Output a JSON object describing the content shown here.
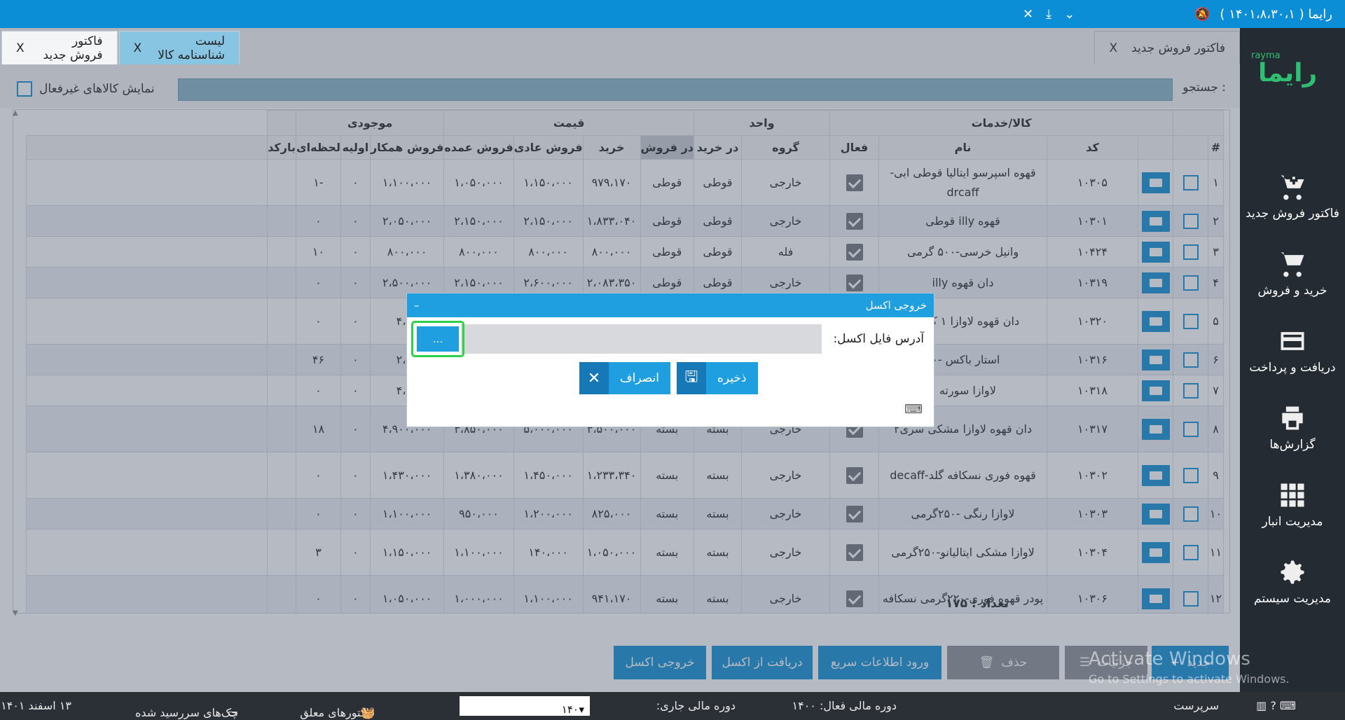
{
  "titlebar": {
    "title": "رایما ( ۱۴۰۱،۸،۳۰،۱ )",
    "icons": [
      "bell-off-icon",
      "chevron-down-icon",
      "minimize-icon",
      "close-icon"
    ]
  },
  "sidebar": {
    "logo_latin": "rayma",
    "logo_text": "رایما",
    "items": [
      {
        "label": "فاکتور فروش جدید",
        "icon": "cart-plus-icon"
      },
      {
        "label": "خرید و فروش",
        "icon": "cart-icon"
      },
      {
        "label": "دریافت و پرداخت",
        "icon": "credit-card-icon"
      },
      {
        "label": "گزارش‌ها",
        "icon": "printer-icon"
      },
      {
        "label": "مدیریت انبار",
        "icon": "grid-icon"
      },
      {
        "label": "مدیریت سیستم",
        "icon": "gear-icon"
      }
    ]
  },
  "tabs": [
    {
      "label": "لیست شناسنامه کالا",
      "close": "X"
    },
    {
      "label": "فاکتور فروش جدید",
      "close": "X"
    }
  ],
  "search": {
    "label": "جستجو :",
    "value": ""
  },
  "inactive_label": "نمایش کالاهای غیرفعال",
  "table": {
    "group_headers": {
      "goods": "کالا/خدمات",
      "unit": "واحد",
      "price": "قیمت",
      "stock": "موجودی"
    },
    "columns": [
      "#",
      "کد",
      "نام",
      "فعال",
      "گروه",
      "در خرید",
      "در فروش",
      "خرید",
      "فروش عادی",
      "فروش عمده",
      "فروش همکار",
      "اولیه",
      "لحظه‌ای",
      "بارکد"
    ],
    "rows": [
      {
        "n": "۱",
        "code": "۱۰۳۰۵",
        "name": "قهوه اسپرسو ایتالیا قوطی ابی-drcaff",
        "group": "خارجی",
        "ub": "قوطی",
        "us": "قوطی",
        "buy": "۹۷۹،۱۷۰",
        "reg": "۱،۱۵۰،۰۰۰",
        "whole": "۱،۰۵۰،۰۰۰",
        "part": "۱،۱۰۰،۰۰۰",
        "init": "۰",
        "now": "-۱"
      },
      {
        "n": "۲",
        "code": "۱۰۳۰۱",
        "name": "قهوه illy قوطی",
        "group": "خارجی",
        "ub": "قوطی",
        "us": "قوطی",
        "buy": "۱،۸۳۳،۰۴۰",
        "reg": "۲،۱۵۰،۰۰۰",
        "whole": "۲،۱۵۰،۰۰۰",
        "part": "۲،۰۵۰،۰۰۰",
        "init": "۰",
        "now": "۰"
      },
      {
        "n": "۳",
        "code": "۱۰۴۲۴",
        "name": "وانیل خرسی-۵۰۰ گرمی",
        "group": "فله",
        "ub": "قوطی",
        "us": "قوطی",
        "buy": "۸۰۰،۰۰۰",
        "reg": "۸۰۰،۰۰۰",
        "whole": "۸۰۰،۰۰۰",
        "part": "۸۰۰،۰۰۰",
        "init": "۰",
        "now": "۱۰"
      },
      {
        "n": "۴",
        "code": "۱۰۳۱۹",
        "name": "دان قهوه illy",
        "group": "خارجی",
        "ub": "قوطی",
        "us": "قوطی",
        "buy": "۲،۰۸۳،۳۵۰",
        "reg": "۲،۶۰۰،۰۰۰",
        "whole": "۲،۱۵۰،۰۰۰",
        "part": "۲،۵۰۰،۰۰۰",
        "init": "۰",
        "now": "۰"
      },
      {
        "n": "۵",
        "code": "۱۰۳۲۰",
        "name": "دان قهوه لاوازا ۱ کیلویی",
        "group": "",
        "ub": "",
        "us": "",
        "buy": "",
        "reg": "",
        "whole": "",
        "part": "۴،۶۰",
        "init": "۰",
        "now": "۰"
      },
      {
        "n": "۶",
        "code": "۱۰۳۱۶",
        "name": "استار باکس -۰۰",
        "group": "",
        "ub": "",
        "us": "",
        "buy": "",
        "reg": "",
        "whole": "",
        "part": "۲،۰۰",
        "init": "۰",
        "now": "۴۶"
      },
      {
        "n": "۷",
        "code": "۱۰۳۱۸",
        "name": "لاوازا سورته ۱",
        "group": "",
        "ub": "",
        "us": "",
        "buy": "",
        "reg": "",
        "whole": "",
        "part": "۴،۴۰",
        "init": "۰",
        "now": "۰"
      },
      {
        "n": "۸",
        "code": "۱۰۳۱۷",
        "name": "دان قهوه لاوازا مشکی سری۲",
        "group": "خارجی",
        "ub": "بسته",
        "us": "بسته",
        "buy": "۳،۵۰۰،۰۰۰",
        "reg": "۵،۰۰۰،۰۰۰",
        "whole": "۳،۸۵۰،۰۰۰",
        "part": "۴،۹۰۰،۰۰۰",
        "init": "۰",
        "now": "۱۸"
      },
      {
        "n": "۹",
        "code": "۱۰۳۰۲",
        "name": "قهوه فوری نسکافه گلد-decaff",
        "group": "خارجی",
        "ub": "بسته",
        "us": "بسته",
        "buy": "۱،۲۳۳،۳۴۰",
        "reg": "۱،۴۵۰،۰۰۰",
        "whole": "۱،۳۸۰،۰۰۰",
        "part": "۱،۴۳۰،۰۰۰",
        "init": "۰",
        "now": "۰"
      },
      {
        "n": "۱۰",
        "code": "۱۰۳۰۳",
        "name": "لاوازا رنگی -۲۵۰گرمی",
        "group": "خارجی",
        "ub": "بسته",
        "us": "بسته",
        "buy": "۸۲۵،۰۰۰",
        "reg": "۱،۲۰۰،۰۰۰",
        "whole": "۹۵۰،۰۰۰",
        "part": "۱،۱۰۰،۰۰۰",
        "init": "۰",
        "now": "۰"
      },
      {
        "n": "۱۱",
        "code": "۱۰۳۰۴",
        "name": "لاوازا مشکی ایتالیانو-۲۵۰گرمی",
        "group": "خارجی",
        "ub": "بسته",
        "us": "بسته",
        "buy": "۱،۰۵۰،۰۰۰",
        "reg": "۱۴۰،۰۰۰",
        "whole": "۱،۱۰۰،۰۰۰",
        "part": "۱،۱۵۰،۰۰۰",
        "init": "۰",
        "now": "۳"
      },
      {
        "n": "۱۲",
        "code": "۱۰۳۰۶",
        "name": "پودر قهوه فوری-۲۲۰گرمی نسکافه",
        "group": "خارجی",
        "ub": "بسته",
        "us": "بسته",
        "buy": "۹۴۱،۱۷۰",
        "reg": "۱،۱۰۰،۰۰۰",
        "whole": "۱،۰۰۰،۰۰۰",
        "part": "۱،۰۵۰،۰۰۰",
        "init": "۰",
        "now": "۰"
      }
    ]
  },
  "count_label": "تعداد : ۱۷۵",
  "buttons": {
    "new": "جدید",
    "new_hint": "Ctrl+N",
    "details": "جزئیات",
    "delete": "حذف",
    "quick": "ورود اطلاعات سریع",
    "import": "دریافت از اکسل",
    "export": "خروجی اکسل"
  },
  "dialog": {
    "title": "خروجی اکسل",
    "minimize": "–",
    "label": "آدرس فایل اکسل:",
    "path": "",
    "browse": "...",
    "save": "ذخیره",
    "cancel": "انصراف"
  },
  "status": {
    "server": "سرپرست",
    "active_period": "دوره مالی فعال: ۱۴۰۰",
    "current_period_label": "دوره مالی جاری:",
    "current_period": "۱۴۰۰",
    "pending_invoices": "فاکتورهای معلق",
    "due_checks": "چک‌های سررسید شده",
    "date": "۱۳ اسفند ۱۴۰۱"
  },
  "watermark": {
    "line1": "Activate Windows",
    "line2": "Go to Settings to activate Windows."
  }
}
